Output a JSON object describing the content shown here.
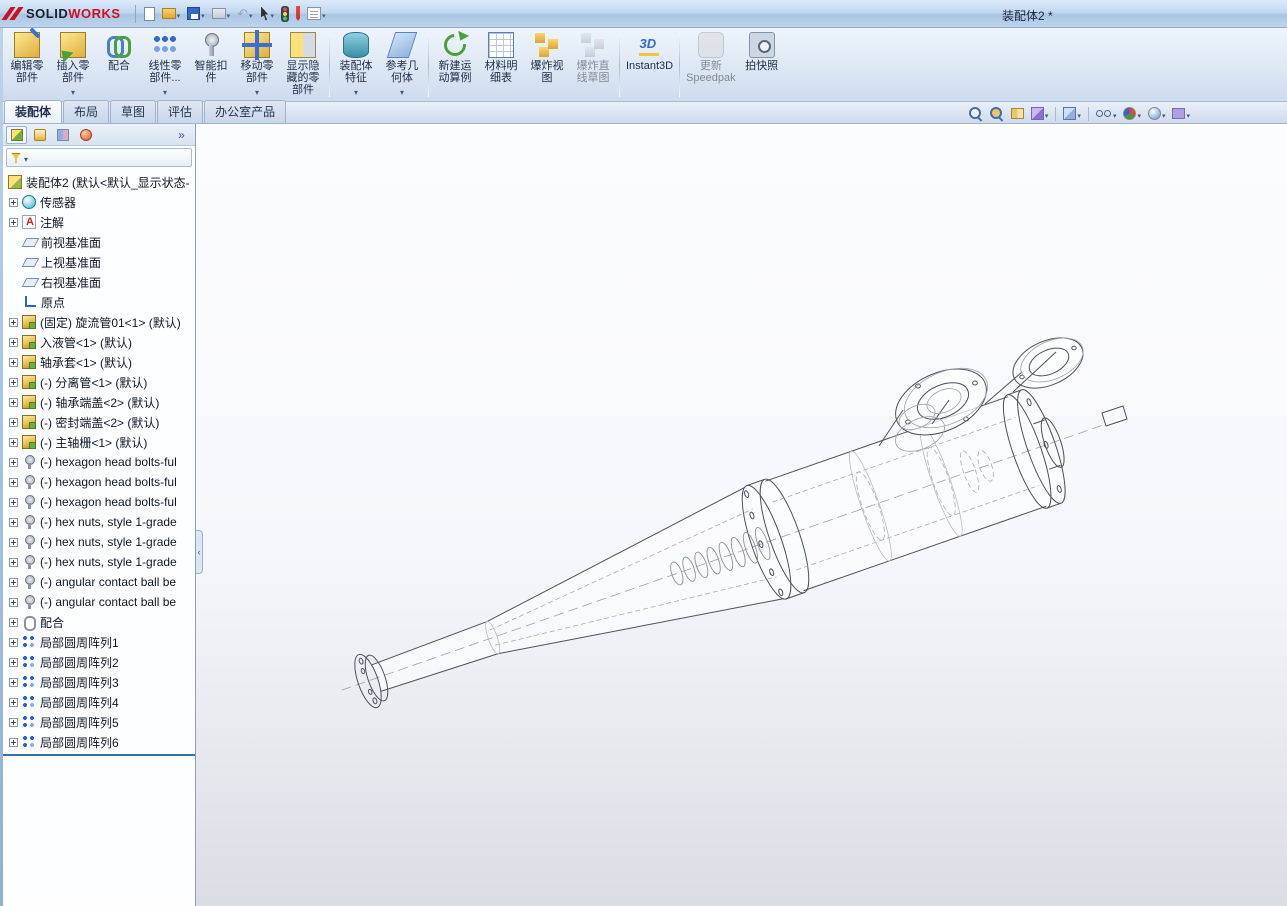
{
  "window": {
    "title": "装配体2 *",
    "brand": {
      "part1": "SOLID",
      "part2": "WORKS"
    }
  },
  "qat": {
    "icons": [
      "new-document-icon",
      "open-icon",
      "save-icon",
      "print-icon",
      "undo-icon",
      "select-arrow-icon",
      "rebuild-traffic-light-icon",
      "red-pencil-icon",
      "options-list-icon"
    ]
  },
  "ribbon": {
    "buttons": [
      {
        "label": "编辑零\n部件",
        "icon": "edit-component-icon",
        "caret": false,
        "disabled": false
      },
      {
        "label": "插入零\n部件",
        "icon": "insert-component-icon",
        "caret": true,
        "disabled": false
      },
      {
        "label": "配合",
        "icon": "mate-icon",
        "caret": false,
        "disabled": false
      },
      {
        "label": "线性零\n部件...",
        "icon": "linear-component-pattern-icon",
        "caret": true,
        "disabled": false
      },
      {
        "label": "智能扣\n件",
        "icon": "smart-fastener-icon",
        "caret": false,
        "disabled": false
      },
      {
        "label": "移动零\n部件",
        "icon": "move-component-icon",
        "caret": true,
        "disabled": false
      },
      {
        "label": "显示隐\n藏的零\n部件",
        "icon": "show-hidden-components-icon",
        "caret": false,
        "disabled": false
      },
      {
        "label": "装配体\n特征",
        "icon": "assembly-features-icon",
        "caret": true,
        "disabled": false
      },
      {
        "label": "参考几\n何体",
        "icon": "reference-geometry-icon",
        "caret": true,
        "disabled": false
      },
      {
        "label": "新建运\n动算例",
        "icon": "new-motion-study-icon",
        "caret": false,
        "disabled": false
      },
      {
        "label": "材料明\n细表",
        "icon": "bill-of-materials-icon",
        "caret": false,
        "disabled": false
      },
      {
        "label": "爆炸视\n图",
        "icon": "exploded-view-icon",
        "caret": false,
        "disabled": false
      },
      {
        "label": "爆炸直\n线草图",
        "icon": "explode-line-sketch-icon",
        "caret": false,
        "disabled": true
      },
      {
        "label": "Instant3D",
        "icon": "instant3d-icon",
        "caret": false,
        "disabled": false
      },
      {
        "label": "更新\nSpeedpak",
        "icon": "update-speedpak-icon",
        "caret": false,
        "disabled": true
      },
      {
        "label": "拍快照",
        "icon": "take-snapshot-icon",
        "caret": false,
        "disabled": false
      }
    ]
  },
  "tabs": {
    "items": [
      "装配体",
      "布局",
      "草图",
      "评估",
      "办公室产品"
    ],
    "active": 0
  },
  "panel": {
    "tabs": [
      "featuremanager",
      "propertymanager",
      "configurationmanager",
      "displaymanager"
    ]
  },
  "tree": {
    "items": [
      {
        "label": "装配体2 (默认<默认_显示状态-",
        "icon": "assembly",
        "plus": false
      },
      {
        "label": "传感器",
        "icon": "sensor",
        "plus": true
      },
      {
        "label": "注解",
        "icon": "annotation",
        "plus": true
      },
      {
        "label": "前视基准面",
        "icon": "plane",
        "plus": false
      },
      {
        "label": "上视基准面",
        "icon": "plane",
        "plus": false
      },
      {
        "label": "右视基准面",
        "icon": "plane",
        "plus": false
      },
      {
        "label": "原点",
        "icon": "origin",
        "plus": false
      },
      {
        "label": "(固定) 旋流管01<1> (默认)",
        "icon": "part",
        "plus": true
      },
      {
        "label": "入液管<1> (默认)",
        "icon": "part",
        "plus": true
      },
      {
        "label": "轴承套<1> (默认)",
        "icon": "part",
        "plus": true
      },
      {
        "label": "(-) 分离管<1> (默认)",
        "icon": "part",
        "plus": true
      },
      {
        "label": "(-) 轴承端盖<2> (默认)",
        "icon": "part",
        "plus": true
      },
      {
        "label": "(-) 密封端盖<2> (默认)",
        "icon": "part",
        "plus": true
      },
      {
        "label": "(-) 主轴栅<1> (默认)",
        "icon": "part",
        "plus": true
      },
      {
        "label": "(-) hexagon head bolts-ful",
        "icon": "fastener",
        "plus": true
      },
      {
        "label": "(-) hexagon head bolts-ful",
        "icon": "fastener",
        "plus": true
      },
      {
        "label": "(-) hexagon head bolts-ful",
        "icon": "fastener",
        "plus": true
      },
      {
        "label": "(-) hex nuts, style 1-grade",
        "icon": "fastener",
        "plus": true
      },
      {
        "label": "(-) hex nuts, style 1-grade",
        "icon": "fastener",
        "plus": true
      },
      {
        "label": "(-) hex nuts, style 1-grade",
        "icon": "fastener",
        "plus": true
      },
      {
        "label": "(-) angular contact ball be",
        "icon": "fastener",
        "plus": true
      },
      {
        "label": "(-) angular contact ball be",
        "icon": "fastener",
        "plus": true
      },
      {
        "label": "配合",
        "icon": "mates",
        "plus": true
      },
      {
        "label": "局部圆周阵列1",
        "icon": "pattern",
        "plus": true
      },
      {
        "label": "局部圆周阵列2",
        "icon": "pattern",
        "plus": true
      },
      {
        "label": "局部圆周阵列3",
        "icon": "pattern",
        "plus": true
      },
      {
        "label": "局部圆周阵列4",
        "icon": "pattern",
        "plus": true
      },
      {
        "label": "局部圆周阵列5",
        "icon": "pattern",
        "plus": true
      },
      {
        "label": "局部圆周阵列6",
        "icon": "pattern",
        "plus": true
      }
    ]
  },
  "hud": {
    "icons": [
      "zoom-fit-icon",
      "zoom-area-icon",
      "section-view-icon",
      "view-orientation-icon",
      "display-style-icon",
      "hide-show-items-icon",
      "edit-appearance-icon",
      "apply-scene-icon",
      "view-settings-icon"
    ]
  }
}
